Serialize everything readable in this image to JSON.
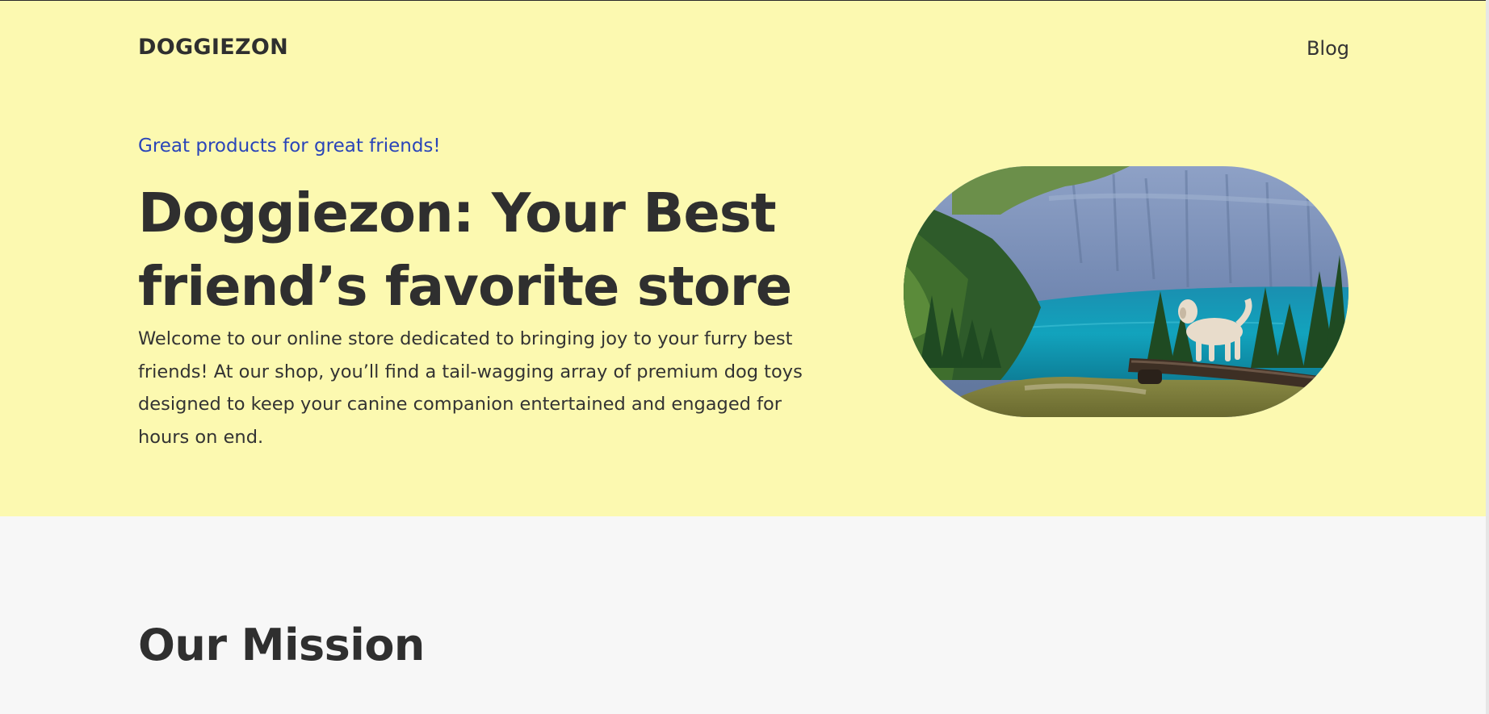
{
  "header": {
    "logo": "DOGGIEZON",
    "nav": [
      "Blog"
    ]
  },
  "hero": {
    "eyebrow": "Great products for great friends!",
    "title": "Doggiezon: Your Best friend’s favorite store",
    "intro": "Welcome to our online store dedicated to bringing joy to your furry best friends! At our shop, you’ll find a tail-wagging array of premium dog toys designed to keep your canine companion entertained and engaged for hours on end.",
    "image_icon": "landscape-photo-dog-by-lake"
  },
  "mission": {
    "title": "Our Mission"
  },
  "colors": {
    "hero_background": "#fcf9b0",
    "section_background": "#f7f7f7",
    "accent_text": "#2a45b9",
    "body_text": "#333333"
  }
}
